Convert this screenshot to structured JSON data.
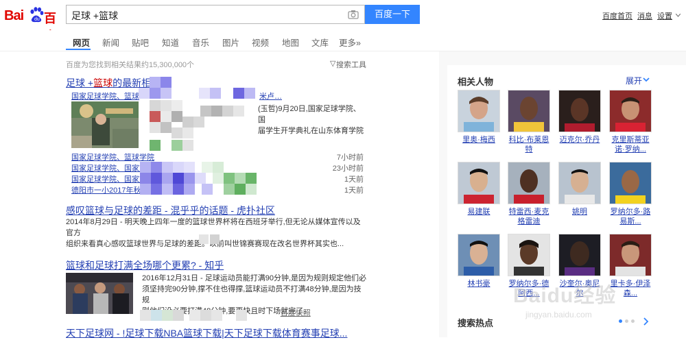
{
  "header": {
    "logo_text_left": "Bai",
    "logo_text_right": "百度",
    "search_value": "足球 +篮球",
    "search_button": "百度一下",
    "links": [
      "百度首页",
      "消息",
      "设置"
    ]
  },
  "tabs": [
    "网页",
    "新闻",
    "贴吧",
    "知道",
    "音乐",
    "图片",
    "视频",
    "地图",
    "文库",
    "更多»"
  ],
  "stats": "百度为您找到相关结果约15,300,000个",
  "tools": "搜索工具",
  "results": {
    "r1": {
      "title_prefix": "足球 +",
      "title_hl": "篮球",
      "title_suffix": "的最新相",
      "sub_title": "国家足球学院、篮球",
      "sub_title_tail": "米卢…",
      "snippet_line1": "(玉哲)9月20日,国家足球学院、国",
      "snippet_line2": "届学生开学典礼在山东体育学院",
      "news": [
        {
          "title": "国家足球学院、篮球学院",
          "time": "7小时前"
        },
        {
          "title": "国家足球学院、国家篮",
          "time": "23小时前"
        },
        {
          "title": "国家足球学院、国家篮",
          "time": "1天前"
        },
        {
          "title": "德阳市一小2017年秋季",
          "time": "1天前"
        }
      ]
    },
    "r2": {
      "title": "感叹篮球与足球的差距 - 混乎乎的话题 - 虎扑社区",
      "line1": "2014年8月29日 - 明天晚上四年一度的篮球世界杯将在西班牙举行,但无论从媒体宣传以及官方",
      "line2": "组织来看真心感叹篮球世界与足球的差距。以前叫世锦赛赛现在改名世界杯其实也..."
    },
    "r3": {
      "title": "篮球和足球打满全场哪个更累? - 知乎",
      "line1": "2016年12月31日 - 足球运动员能打满90分钟,是因为规则规定他们必",
      "line2": "须坚持完90分钟,撑不住也得撑,篮球运动员不打满48分钟,是因为技规",
      "line3": "则他们没必要打满48分钟,要更快且时下场就完了。",
      "snapshot": "百度快照"
    },
    "r4": {
      "title": "天下足球网 - !足球下载NBA篮球下载|天下足球下载体育赛事足球..."
    }
  },
  "sidebar": {
    "people_title": "相关人物",
    "expand": "展开",
    "people": [
      {
        "name": "里奥·梅西"
      },
      {
        "name": "科比·布莱恩特"
      },
      {
        "name": "迈克尔·乔丹"
      },
      {
        "name": "克里斯蒂亚诺·罗纳..."
      },
      {
        "name": "易建联"
      },
      {
        "name": "特雷西·麦克格雷迪"
      },
      {
        "name": "姚明"
      },
      {
        "name": "罗纳尔多·路易斯..."
      },
      {
        "name": "林书豪"
      },
      {
        "name": "罗纳尔多·德阿西..."
      },
      {
        "name": "沙奎尔·奥尼尔"
      },
      {
        "name": "里卡多·伊泽森..."
      }
    ],
    "hot_title": "搜索热点"
  },
  "watermark": {
    "text": "Baidu经验",
    "url": "jingyan.baidu.com"
  },
  "colors": {
    "brand_red": "#e10601",
    "link_blue": "#2440b3",
    "button_blue": "#3385ff",
    "highlight_red": "#c00"
  }
}
